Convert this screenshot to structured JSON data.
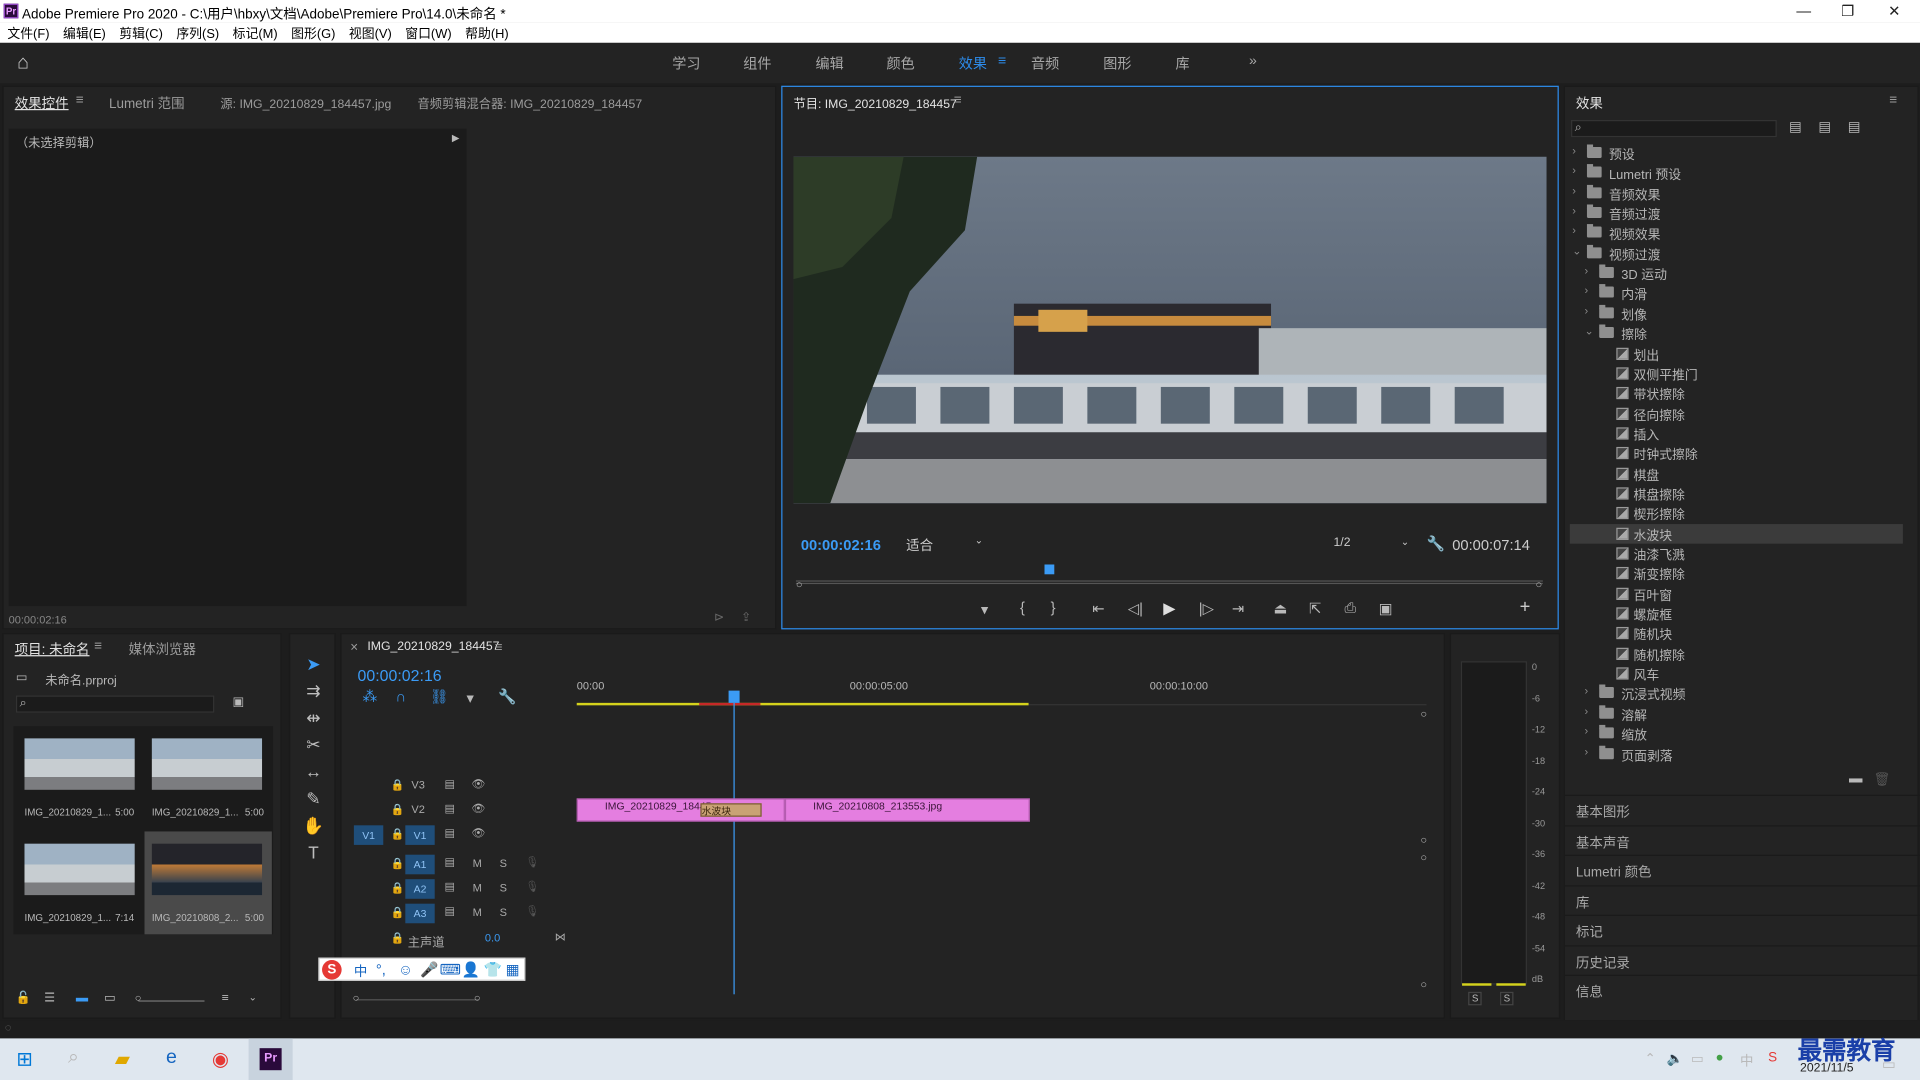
{
  "app": {
    "title": "Adobe Premiere Pro 2020 - C:\\用户\\hbxy\\文档\\Adobe\\Premiere Pro\\14.0\\未命名 *",
    "logo": "Pr"
  },
  "menu": [
    "文件(F)",
    "编辑(E)",
    "剪辑(C)",
    "序列(S)",
    "标记(M)",
    "图形(G)",
    "视图(V)",
    "窗口(W)",
    "帮助(H)"
  ],
  "workspaces": {
    "items": [
      "学习",
      "组件",
      "编辑",
      "颜色",
      "效果",
      "音频",
      "图形",
      "库"
    ],
    "active": "效果",
    "more": "»"
  },
  "source_panel": {
    "tabs": [
      "效果控件",
      "Lumetri 范围",
      "源: IMG_20210829_184457.jpg",
      "音频剪辑混合器: IMG_20210829_184457"
    ],
    "no_clip": "（未选择剪辑）",
    "timecode": "00:00:02:16"
  },
  "program": {
    "title": "节目: IMG_20210829_184457",
    "timecode": "00:00:02:16",
    "fit": "适合",
    "quality": "1/2",
    "duration": "00:00:07:14",
    "playhead_fraction": 0.34
  },
  "effects": {
    "title": "效果",
    "search_placeholder": "",
    "tree": [
      {
        "label": "预设",
        "level": 0,
        "type": "folder",
        "open": false
      },
      {
        "label": "Lumetri 预设",
        "level": 0,
        "type": "folder",
        "open": false
      },
      {
        "label": "音频效果",
        "level": 0,
        "type": "folder",
        "open": false
      },
      {
        "label": "音频过渡",
        "level": 0,
        "type": "folder",
        "open": false
      },
      {
        "label": "视频效果",
        "level": 0,
        "type": "folder",
        "open": false
      },
      {
        "label": "视频过渡",
        "level": 0,
        "type": "folder",
        "open": true
      },
      {
        "label": "3D 运动",
        "level": 1,
        "type": "folder",
        "open": false
      },
      {
        "label": "内滑",
        "level": 1,
        "type": "folder",
        "open": false
      },
      {
        "label": "划像",
        "level": 1,
        "type": "folder",
        "open": false
      },
      {
        "label": "擦除",
        "level": 1,
        "type": "folder",
        "open": true
      },
      {
        "label": "划出",
        "level": 2,
        "type": "fx"
      },
      {
        "label": "双侧平推门",
        "level": 2,
        "type": "fx"
      },
      {
        "label": "带状擦除",
        "level": 2,
        "type": "fx"
      },
      {
        "label": "径向擦除",
        "level": 2,
        "type": "fx"
      },
      {
        "label": "插入",
        "level": 2,
        "type": "fx"
      },
      {
        "label": "时钟式擦除",
        "level": 2,
        "type": "fx"
      },
      {
        "label": "棋盘",
        "level": 2,
        "type": "fx"
      },
      {
        "label": "棋盘擦除",
        "level": 2,
        "type": "fx"
      },
      {
        "label": "楔形擦除",
        "level": 2,
        "type": "fx"
      },
      {
        "label": "水波块",
        "level": 2,
        "type": "fx",
        "selected": true
      },
      {
        "label": "油漆飞溅",
        "level": 2,
        "type": "fx"
      },
      {
        "label": "渐变擦除",
        "level": 2,
        "type": "fx"
      },
      {
        "label": "百叶窗",
        "level": 2,
        "type": "fx"
      },
      {
        "label": "螺旋框",
        "level": 2,
        "type": "fx"
      },
      {
        "label": "随机块",
        "level": 2,
        "type": "fx"
      },
      {
        "label": "随机擦除",
        "level": 2,
        "type": "fx"
      },
      {
        "label": "风车",
        "level": 2,
        "type": "fx"
      },
      {
        "label": "沉浸式视频",
        "level": 1,
        "type": "folder",
        "open": false
      },
      {
        "label": "溶解",
        "level": 1,
        "type": "folder",
        "open": false
      },
      {
        "label": "缩放",
        "level": 1,
        "type": "folder",
        "open": false
      },
      {
        "label": "页面剥落",
        "level": 1,
        "type": "folder",
        "open": false
      }
    ],
    "sections": [
      "基本图形",
      "基本声音",
      "Lumetri 颜色",
      "库",
      "标记",
      "历史记录",
      "信息"
    ]
  },
  "project": {
    "tabs": [
      "项目: 未命名",
      "媒体浏览器"
    ],
    "file": "未命名.prproj",
    "items": [
      {
        "name": "IMG_20210829_1...",
        "dur": "5:00"
      },
      {
        "name": "IMG_20210829_1...",
        "dur": "5:00"
      },
      {
        "name": "IMG_20210829_1...",
        "dur": "7:14"
      },
      {
        "name": "IMG_20210808_2...",
        "dur": "5:00"
      }
    ]
  },
  "timeline": {
    "tab": "IMG_20210829_184457",
    "timecode": "00:00:02:16",
    "ruler": [
      "00:00",
      "00:00:05:00",
      "00:00:10:00"
    ],
    "video_tracks": [
      "V3",
      "V2",
      "V1"
    ],
    "audio_tracks": [
      "A1",
      "A2",
      "A3"
    ],
    "source_patch": "V1",
    "master": "主声道",
    "master_val": "0.0",
    "clips": [
      {
        "label": "IMG_20210829_18445"
      },
      {
        "label": "IMG_20210808_213553.jpg"
      }
    ],
    "transition": "水波块"
  },
  "meter": {
    "ticks": [
      "0",
      "-6",
      "-12",
      "-18",
      "-24",
      "-30",
      "-36",
      "-42",
      "-48",
      "-54",
      "dB"
    ],
    "solo": [
      "S",
      "S"
    ]
  },
  "ime": {
    "label": "中"
  },
  "taskbar": {
    "date": "2021/11/5",
    "watermark": "最需教育"
  }
}
